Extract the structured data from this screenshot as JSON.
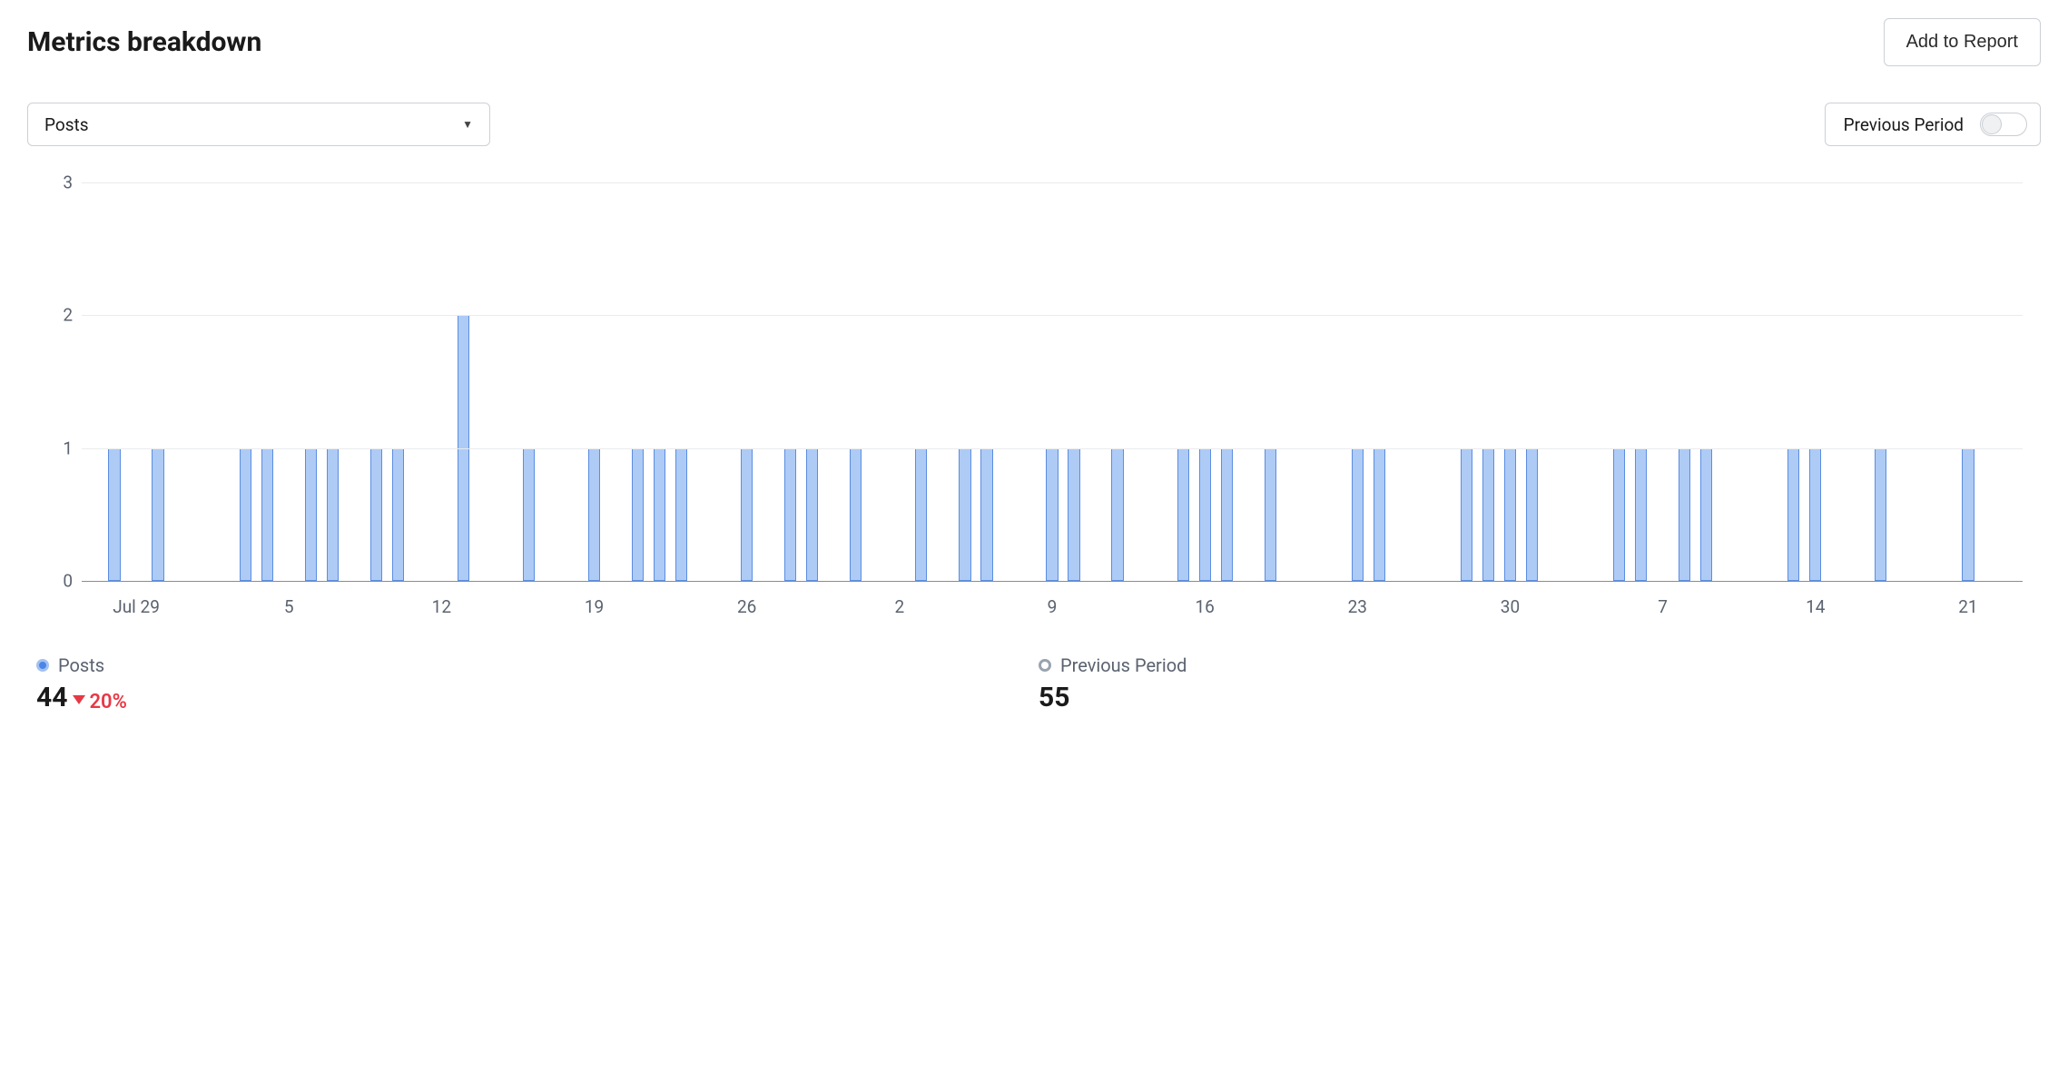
{
  "header": {
    "title": "Metrics breakdown",
    "add_button": "Add to Report"
  },
  "controls": {
    "dropdown_selected": "Posts",
    "toggle_label": "Previous Period",
    "toggle_on": false
  },
  "chart_data": {
    "type": "bar",
    "ylabel": "",
    "xlabel": "",
    "ylim": [
      0,
      3
    ],
    "yticks": [
      0,
      1,
      2,
      3
    ],
    "x_tick_labels": [
      {
        "index": 2,
        "label": "Jul 29"
      },
      {
        "index": 9,
        "label": "5"
      },
      {
        "index": 16,
        "label": "12"
      },
      {
        "index": 23,
        "label": "19"
      },
      {
        "index": 30,
        "label": "26"
      },
      {
        "index": 37,
        "label": "2"
      },
      {
        "index": 44,
        "label": "9"
      },
      {
        "index": 51,
        "label": "16"
      },
      {
        "index": 58,
        "label": "23"
      },
      {
        "index": 65,
        "label": "30"
      },
      {
        "index": 72,
        "label": "7"
      },
      {
        "index": 79,
        "label": "14"
      },
      {
        "index": 86,
        "label": "21"
      }
    ],
    "num_slots": 89,
    "series": [
      {
        "name": "Posts",
        "values_by_index": {
          "1": 1,
          "3": 1,
          "7": 1,
          "8": 1,
          "10": 1,
          "11": 1,
          "13": 1,
          "14": 1,
          "17": 2,
          "20": 1,
          "23": 1,
          "25": 1,
          "26": 1,
          "27": 1,
          "30": 1,
          "32": 1,
          "33": 1,
          "35": 1,
          "38": 1,
          "40": 1,
          "41": 1,
          "44": 1,
          "45": 1,
          "47": 1,
          "50": 1,
          "51": 1,
          "52": 1,
          "54": 1,
          "58": 1,
          "59": 1,
          "63": 1,
          "64": 1,
          "65": 1,
          "66": 1,
          "70": 1,
          "71": 1,
          "73": 1,
          "74": 1,
          "78": 1,
          "79": 1,
          "82": 1,
          "86": 1
        }
      }
    ]
  },
  "legend": {
    "current": {
      "label": "Posts",
      "value": "44",
      "change_pct": "20%",
      "change_dir": "down"
    },
    "previous": {
      "label": "Previous Period",
      "value": "55"
    }
  }
}
